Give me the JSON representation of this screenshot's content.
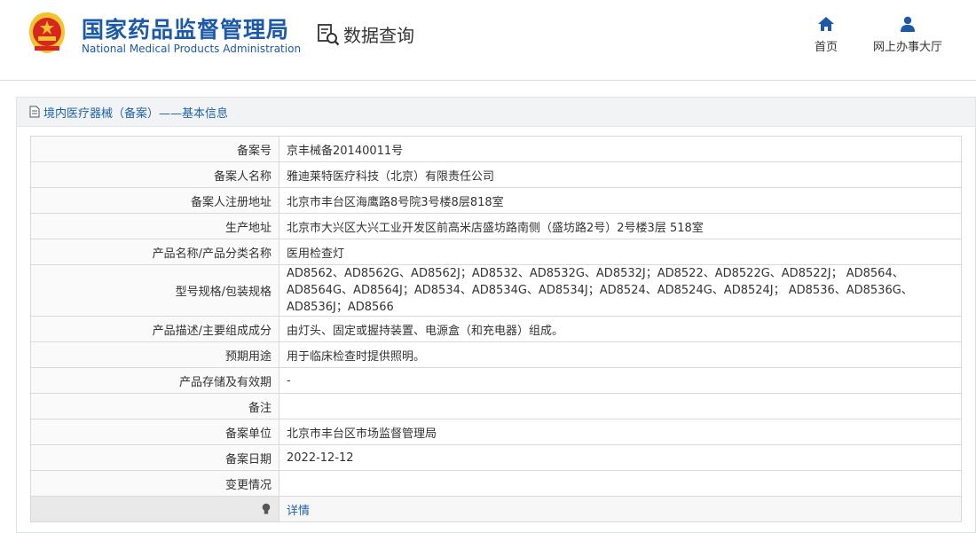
{
  "header": {
    "brand_cn": "国家药品监督管理局",
    "brand_en": "National Medical Products Administration",
    "query_label": "数据查询",
    "nav": [
      {
        "label": "首页",
        "icon": "home-icon"
      },
      {
        "label": "网上办事大厅",
        "icon": "user-icon"
      }
    ]
  },
  "colors": {
    "brand": "#1c5aa8",
    "emblem_red": "#d7261e",
    "emblem_gold": "#f4c32d",
    "link": "#1e63a6"
  },
  "panel": {
    "title": "境内医疗器械（备案）——基本信息",
    "icon": "document-icon"
  },
  "rows": [
    {
      "label": "备案号",
      "value": "京丰械备20140011号"
    },
    {
      "label": "备案人名称",
      "value": "雅迪莱特医疗科技（北京）有限责任公司"
    },
    {
      "label": "备案人注册地址",
      "value": "北京市丰台区海鹰路8号院3号楼8层818室"
    },
    {
      "label": "生产地址",
      "value": "北京市大兴区大兴工业开发区前高米店盛坊路南侧（盛坊路2号）2号楼3层 518室"
    },
    {
      "label": "产品名称/产品分类名称",
      "value": "医用检查灯"
    },
    {
      "label": "型号规格/包装规格",
      "value": "AD8562、AD8562G、AD8562J；AD8532、AD8532G、AD8532J；AD8522、AD8522G、AD8522J； AD8564、AD8564G、AD8564J；AD8534、AD8534G、AD8534J；AD8524、AD8524G、AD8524J； AD8536、AD8536G、AD8536J；AD8566"
    },
    {
      "label": "产品描述/主要组成成分",
      "value": "由灯头、固定或握持装置、电源盒（和充电器）组成。"
    },
    {
      "label": "预期用途",
      "value": "用于临床检查时提供照明。"
    },
    {
      "label": "产品存储及有效期",
      "value": "-"
    },
    {
      "label": "备注",
      "value": ""
    },
    {
      "label": "备案单位",
      "value": "北京市丰台区市场监督管理局"
    },
    {
      "label": "备案日期",
      "value": "2022-12-12"
    },
    {
      "label": "变更情况",
      "value": ""
    }
  ],
  "last_row": {
    "icon": "lightbulb-icon",
    "link_label": "详情"
  }
}
